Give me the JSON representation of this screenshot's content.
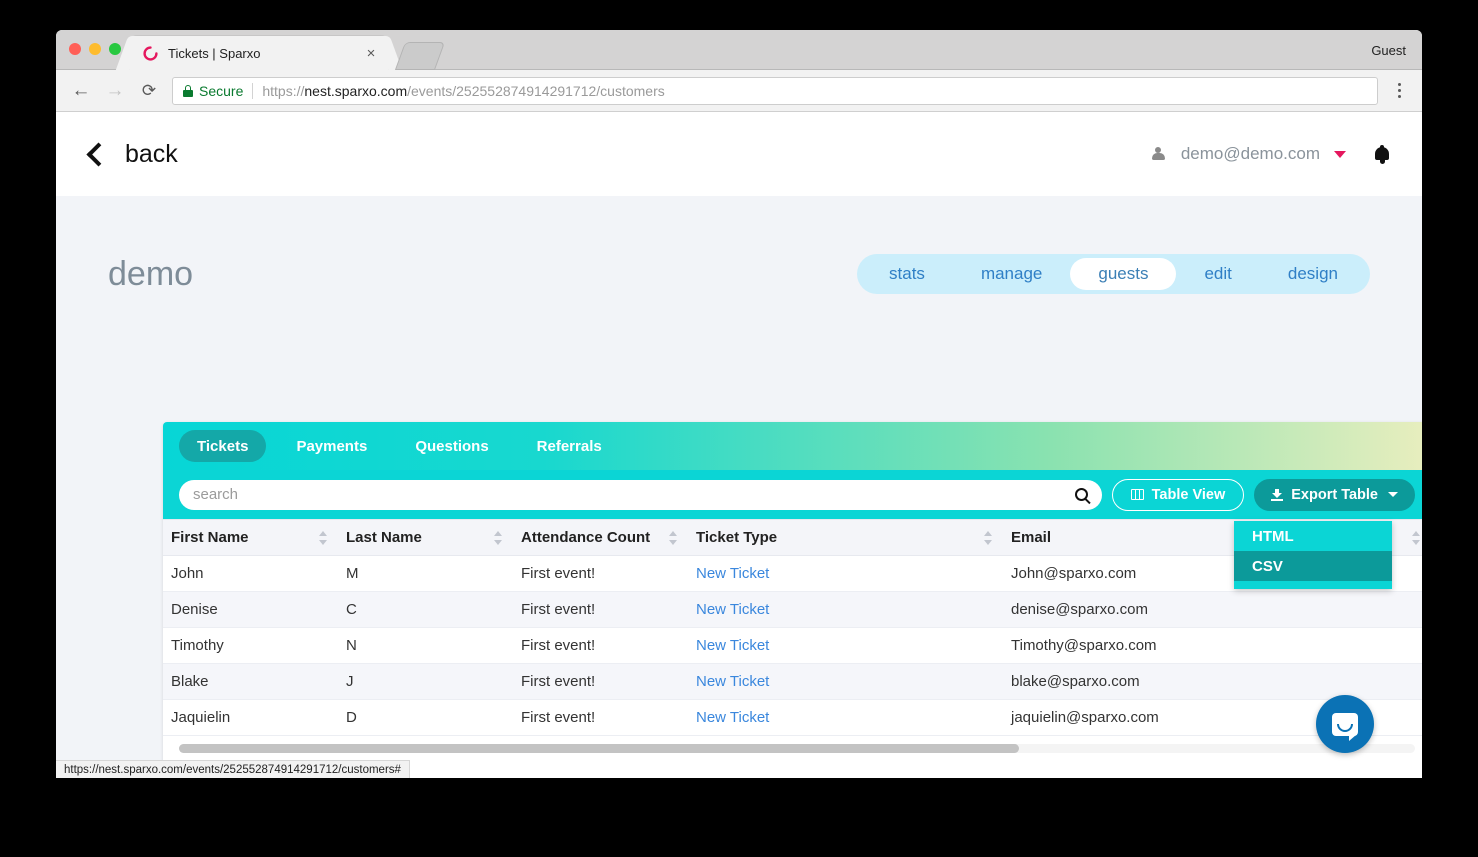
{
  "browser": {
    "tab_title": "Tickets | Sparxo",
    "tab_close": "×",
    "profile_label": "Guest",
    "back_glyph": "←",
    "forward_glyph": "→",
    "reload_glyph": "⟳",
    "secure_label": "Secure",
    "url_scheme": "https://",
    "url_host": "nest.sparxo.com",
    "url_path": "/events/252552874914291712/customers",
    "status_url": "https://nest.sparxo.com/events/252552874914291712/customers#"
  },
  "app_header": {
    "back_label": "back",
    "user_email": "demo@demo.com"
  },
  "page": {
    "event_title": "demo",
    "nav_pills": [
      {
        "label": "stats",
        "active": false
      },
      {
        "label": "manage",
        "active": false
      },
      {
        "label": "guests",
        "active": true
      },
      {
        "label": "edit",
        "active": false
      },
      {
        "label": "design",
        "active": false
      }
    ]
  },
  "panel": {
    "subtabs": [
      {
        "label": "Tickets",
        "active": true
      },
      {
        "label": "Payments",
        "active": false
      },
      {
        "label": "Questions",
        "active": false
      },
      {
        "label": "Referrals",
        "active": false
      }
    ],
    "search": {
      "value": "",
      "placeholder": "search"
    },
    "table_view_label": "Table View",
    "export_label": "Export Table",
    "export_menu": [
      {
        "label": "HTML",
        "hovered": false
      },
      {
        "label": "CSV",
        "hovered": true
      }
    ]
  },
  "table": {
    "columns": [
      "First Name",
      "Last Name",
      "Attendance Count",
      "Ticket Type",
      "Email",
      ""
    ],
    "rows": [
      {
        "first": "John",
        "last": "M",
        "attendance": "First event!",
        "ticket": "New Ticket",
        "email": "John@sparxo.com"
      },
      {
        "first": "Denise",
        "last": "C",
        "attendance": "First event!",
        "ticket": "New Ticket",
        "email": "denise@sparxo.com"
      },
      {
        "first": "Timothy",
        "last": "N",
        "attendance": "First event!",
        "ticket": "New Ticket",
        "email": "Timothy@sparxo.com"
      },
      {
        "first": "Blake",
        "last": "J",
        "attendance": "First event!",
        "ticket": "New Ticket",
        "email": "blake@sparxo.com"
      },
      {
        "first": "Jaquielin",
        "last": "D",
        "attendance": "First event!",
        "ticket": "New Ticket",
        "email": "jaquielin@sparxo.com"
      }
    ]
  },
  "colors": {
    "teal_bright": "#0bd5d5",
    "teal_dark": "#0c9a9a",
    "gradient_end": "#e9eebe",
    "pill_bg": "#cbeefb",
    "pill_text": "#2f7fc6",
    "link_blue": "#3a87dd",
    "accent_pink": "#e5175e",
    "intercom_blue": "#0b72b5",
    "secure_green": "#0a7a2f"
  }
}
